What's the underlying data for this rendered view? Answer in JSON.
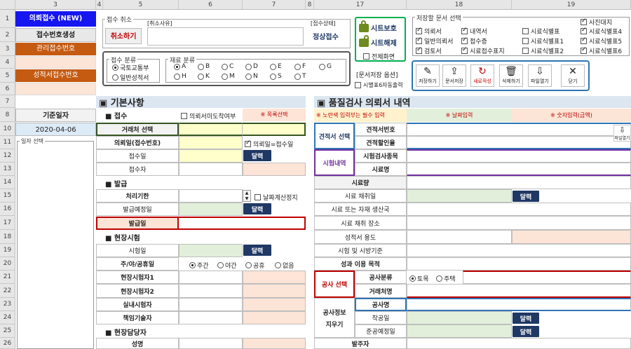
{
  "column_headers": [
    "3",
    "4",
    "5",
    "6",
    "7",
    "8",
    "17",
    "18",
    "19"
  ],
  "row_headers": [
    "1",
    "2",
    "3",
    "4",
    "5",
    "6",
    "7",
    "8",
    "10",
    "11",
    "12",
    "13",
    "14",
    "15",
    "16",
    "17",
    "18",
    "19",
    "20",
    "21",
    "22",
    "23",
    "24",
    "25",
    "26"
  ],
  "left_panel": {
    "new_receipt": "의뢰접수 (NEW)",
    "gen_number": "접수번호생성",
    "mgmt_number": "관리접수번호",
    "report_number": "성적서접수번호",
    "base_date_label": "기준일자",
    "base_date_value": "2020-04-06",
    "date_select_label": "일자 선택"
  },
  "cancel_box": {
    "legend": "접수 취소",
    "button": "취소하기",
    "reason_label": "[취소사유]",
    "status_label": "[접수상태]",
    "status_value": "정상접수"
  },
  "sheet_box": {
    "protect": "시트보호",
    "unprotect": "시트해제",
    "fullscreen": "전체화면"
  },
  "doc_select": {
    "legend": "저장할 문서 선택",
    "col1": [
      "의뢰서",
      "일반의뢰서",
      "검토서"
    ],
    "col2": [
      "내역서",
      "접수증",
      "시료접수표지"
    ],
    "col3": [
      "시료식별표",
      "시료식별표1",
      "시료식별표2"
    ],
    "col4": [
      "사진대지",
      "시료식별표4",
      "시료식별표5",
      "시료식별표6"
    ]
  },
  "category_box": {
    "receipt_legend": "접수 분류",
    "receipt_opts": [
      "국토교통부",
      "일반성적서"
    ],
    "material_legend": "재료 분류",
    "material_row1": [
      "A",
      "B",
      "C",
      "D",
      "E",
      "F",
      "G"
    ],
    "material_row2": [
      "H",
      "K",
      "M",
      "N",
      "S",
      "T"
    ]
  },
  "save_opts": {
    "legend": "[문서저장 옵션]",
    "option": "시별표6자동출력"
  },
  "toolbar": {
    "save": "저장하기",
    "doc_save": "문서저장",
    "new": "새로작성",
    "delete": "삭제하기",
    "open": "파일열기",
    "close": "닫기"
  },
  "basic": {
    "title": "▣ 기본사항",
    "receipt_title": "■ 접수",
    "non_visit_label": "의뢰서미도착여부",
    "list_select": "※ 목록선택",
    "client_select": "거래처 선택",
    "request_date": "의뢰일(접수번호)",
    "same_date_chk": "의뢰일=접수일",
    "receipt_date": "접수일",
    "receiver": "접수자",
    "issue_title": "■ 발급",
    "deadline": "처리기한",
    "stop_calc": "날짜계산정지",
    "planned_issue": "발급예정일",
    "issue_date": "발급일",
    "site_title": "■ 현장시험",
    "test_date": "시험일",
    "day_night_label": "주/야/공휴일",
    "day_night_opts": [
      "주간",
      "야간",
      "공휴",
      "없음"
    ],
    "site_tester1": "현장시험자1",
    "site_tester2": "현장시험자2",
    "indoor_tester": "실내시험자",
    "chief_tech": "책임기술자",
    "manager_title": "■ 현장담당자",
    "name": "성명",
    "cal_button": "달력"
  },
  "quality": {
    "title": "▣ 품질검사 의뢰서 내역",
    "note_yellow": "※ 노란색 입력부는 필수 입력",
    "note_date": "※ 날짜입력",
    "note_number": "※ 숫자입력(금액)",
    "estimate_select": "견적서 선택",
    "estimate_no": "견적서번호",
    "estimate_discount": "견적할인율",
    "file_open": "파일열기",
    "test_detail": "시험내역",
    "test_item": "시험검사종목",
    "sample_name": "시료명",
    "sample_qty": "시료량",
    "sample_taker": "시료 채취일",
    "sample_maker": "시료 또는 자재 생산국",
    "sample_place": "시료 채취 장소",
    "report_use": "성적서 용도",
    "test_standard": "시험 및 시방기준",
    "result_use": "성과 이용 목적",
    "work_select": "공사 선택",
    "work_type": "공사분류",
    "work_type_opts": [
      "토목",
      "주택"
    ],
    "client_name": "거래처명",
    "work_info": "공사정보",
    "keep": "지우기",
    "work_name": "공사명",
    "start_date": "착공일",
    "end_date": "준공예정일",
    "orderer": "발주자",
    "cal_button": "달력"
  }
}
